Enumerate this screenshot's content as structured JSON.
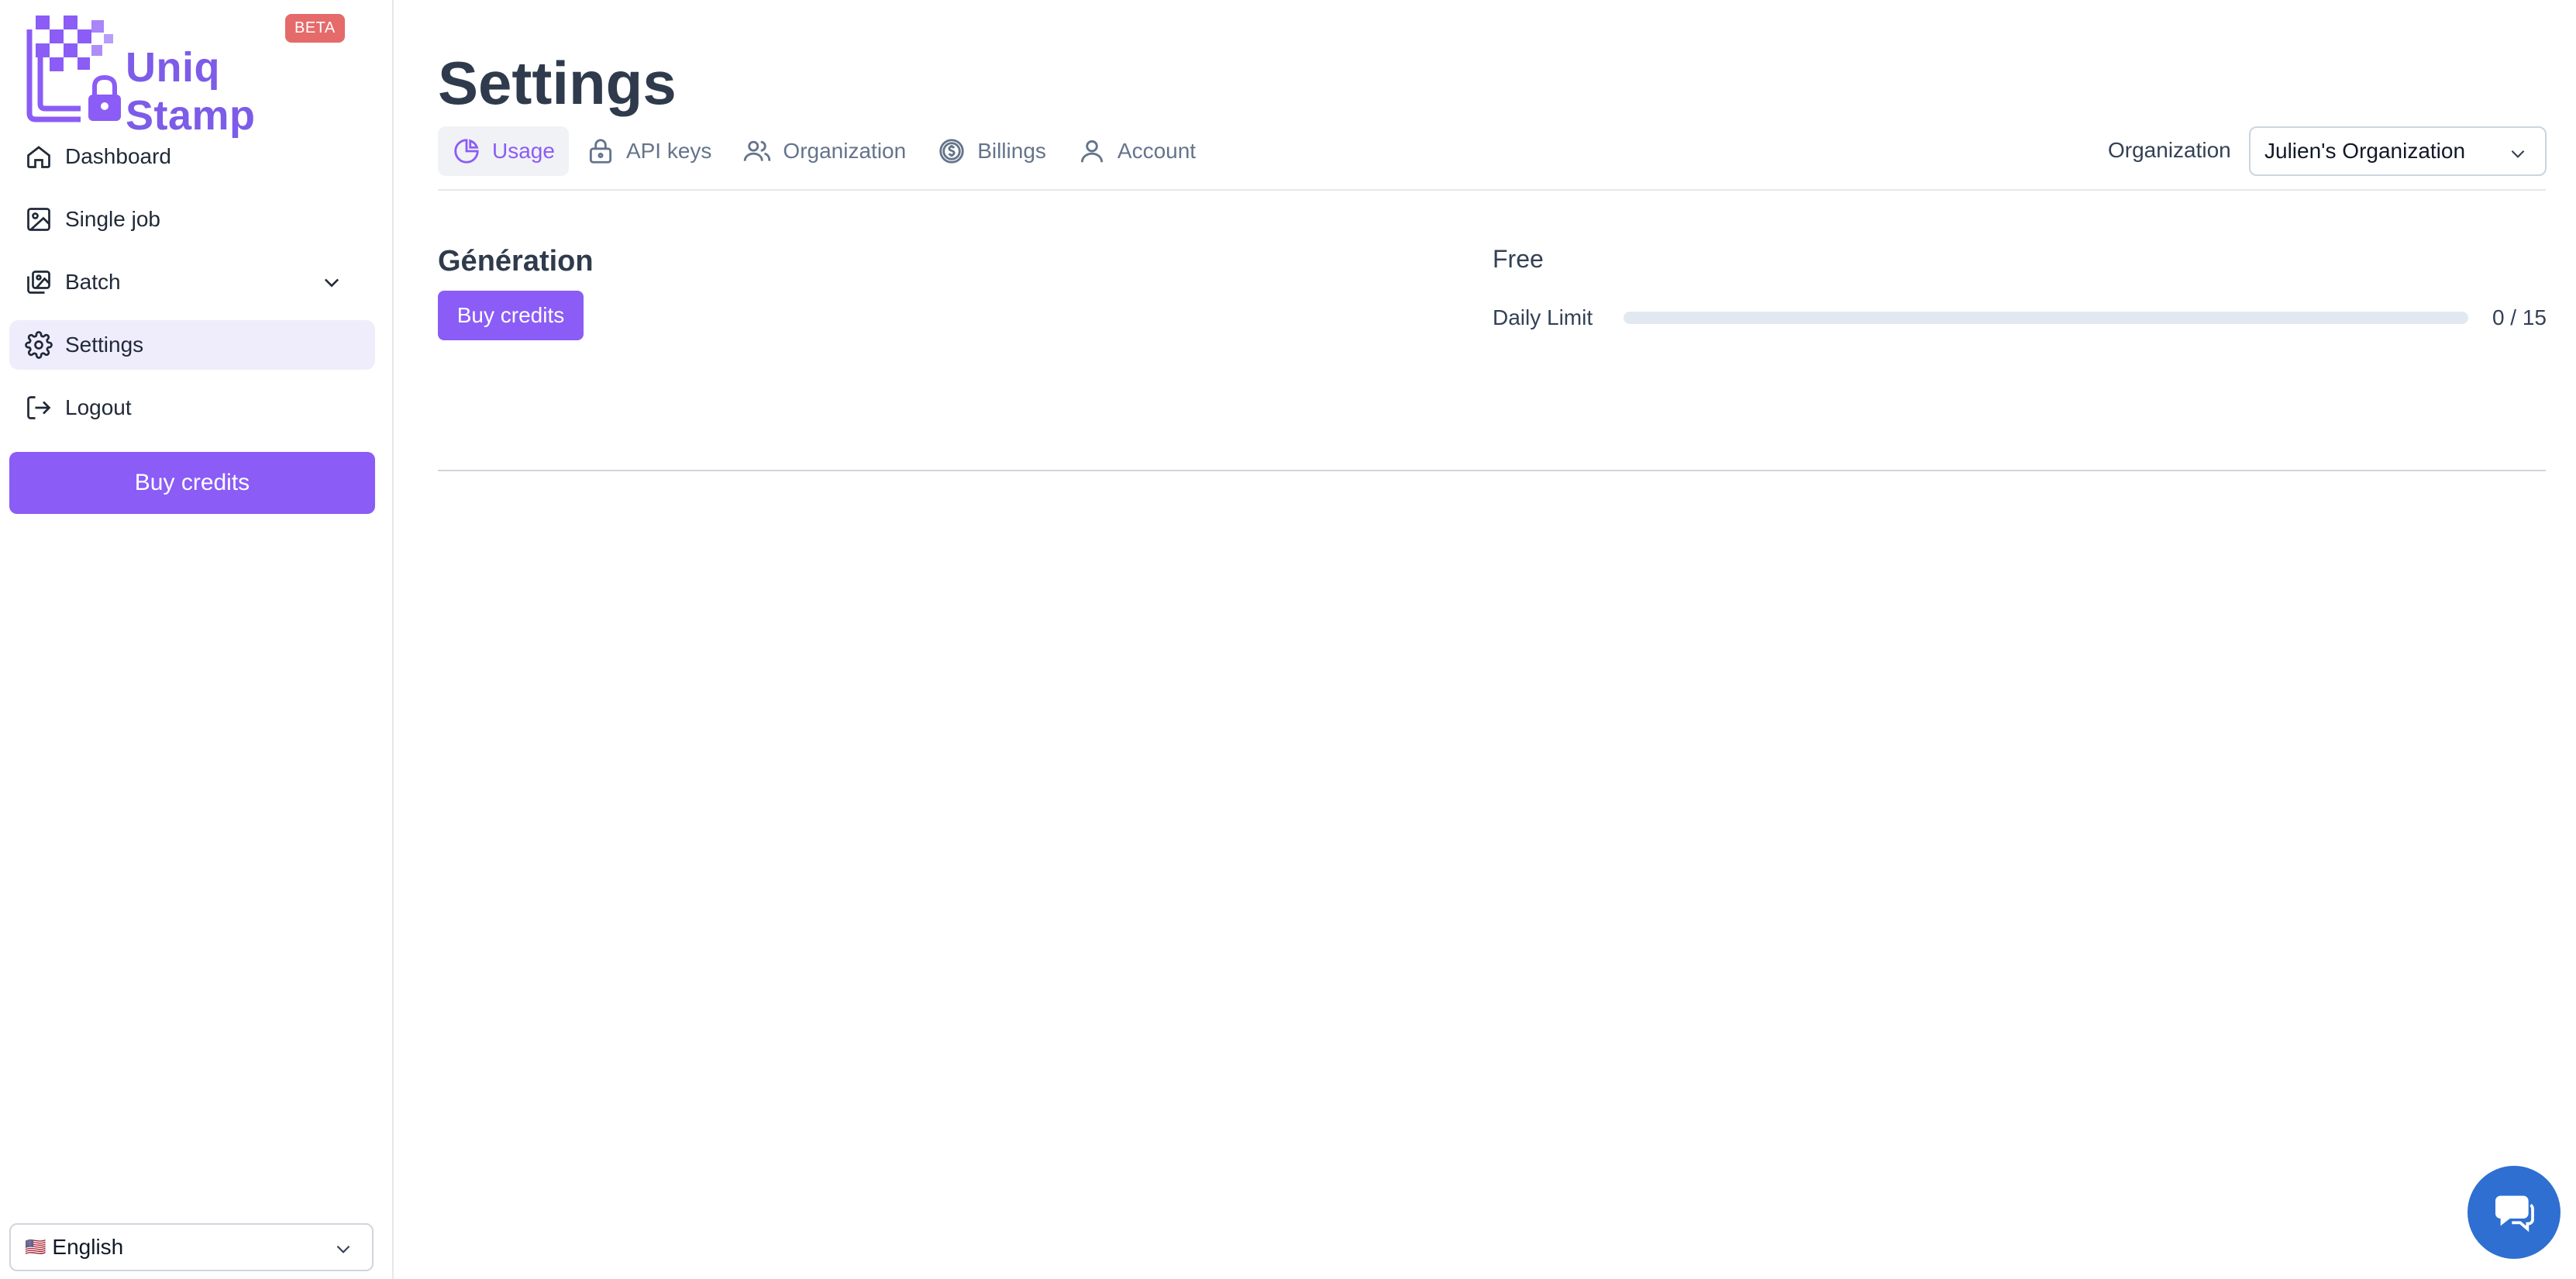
{
  "app": {
    "name": "Uniq Stamp",
    "badge": "BETA",
    "brand_color": "#8b5cf6"
  },
  "sidebar": {
    "items": [
      {
        "label": "Dashboard",
        "icon": "home-icon"
      },
      {
        "label": "Single job",
        "icon": "image-icon"
      },
      {
        "label": "Batch",
        "icon": "images-icon"
      },
      {
        "label": "Settings",
        "icon": "gear-icon",
        "active": true
      },
      {
        "label": "Logout",
        "icon": "logout-icon"
      }
    ],
    "buy_label": "Buy credits",
    "language": {
      "flag": "🇺🇸",
      "label": "English"
    }
  },
  "page": {
    "title": "Settings",
    "tabs": [
      {
        "label": "Usage",
        "icon": "pie-chart-icon",
        "active": true
      },
      {
        "label": "API keys",
        "icon": "lock-icon"
      },
      {
        "label": "Organization",
        "icon": "users-icon"
      },
      {
        "label": "Billings",
        "icon": "dollar-icon"
      },
      {
        "label": "Account",
        "icon": "user-icon"
      }
    ],
    "org_label": "Organization",
    "org_value": "Julien's Organization"
  },
  "usage": {
    "section_title": "Génération",
    "buy_label": "Buy credits",
    "plan_name": "Free",
    "limit_label": "Daily Limit",
    "used": 0,
    "total": 15,
    "count_text": "0 / 15"
  }
}
